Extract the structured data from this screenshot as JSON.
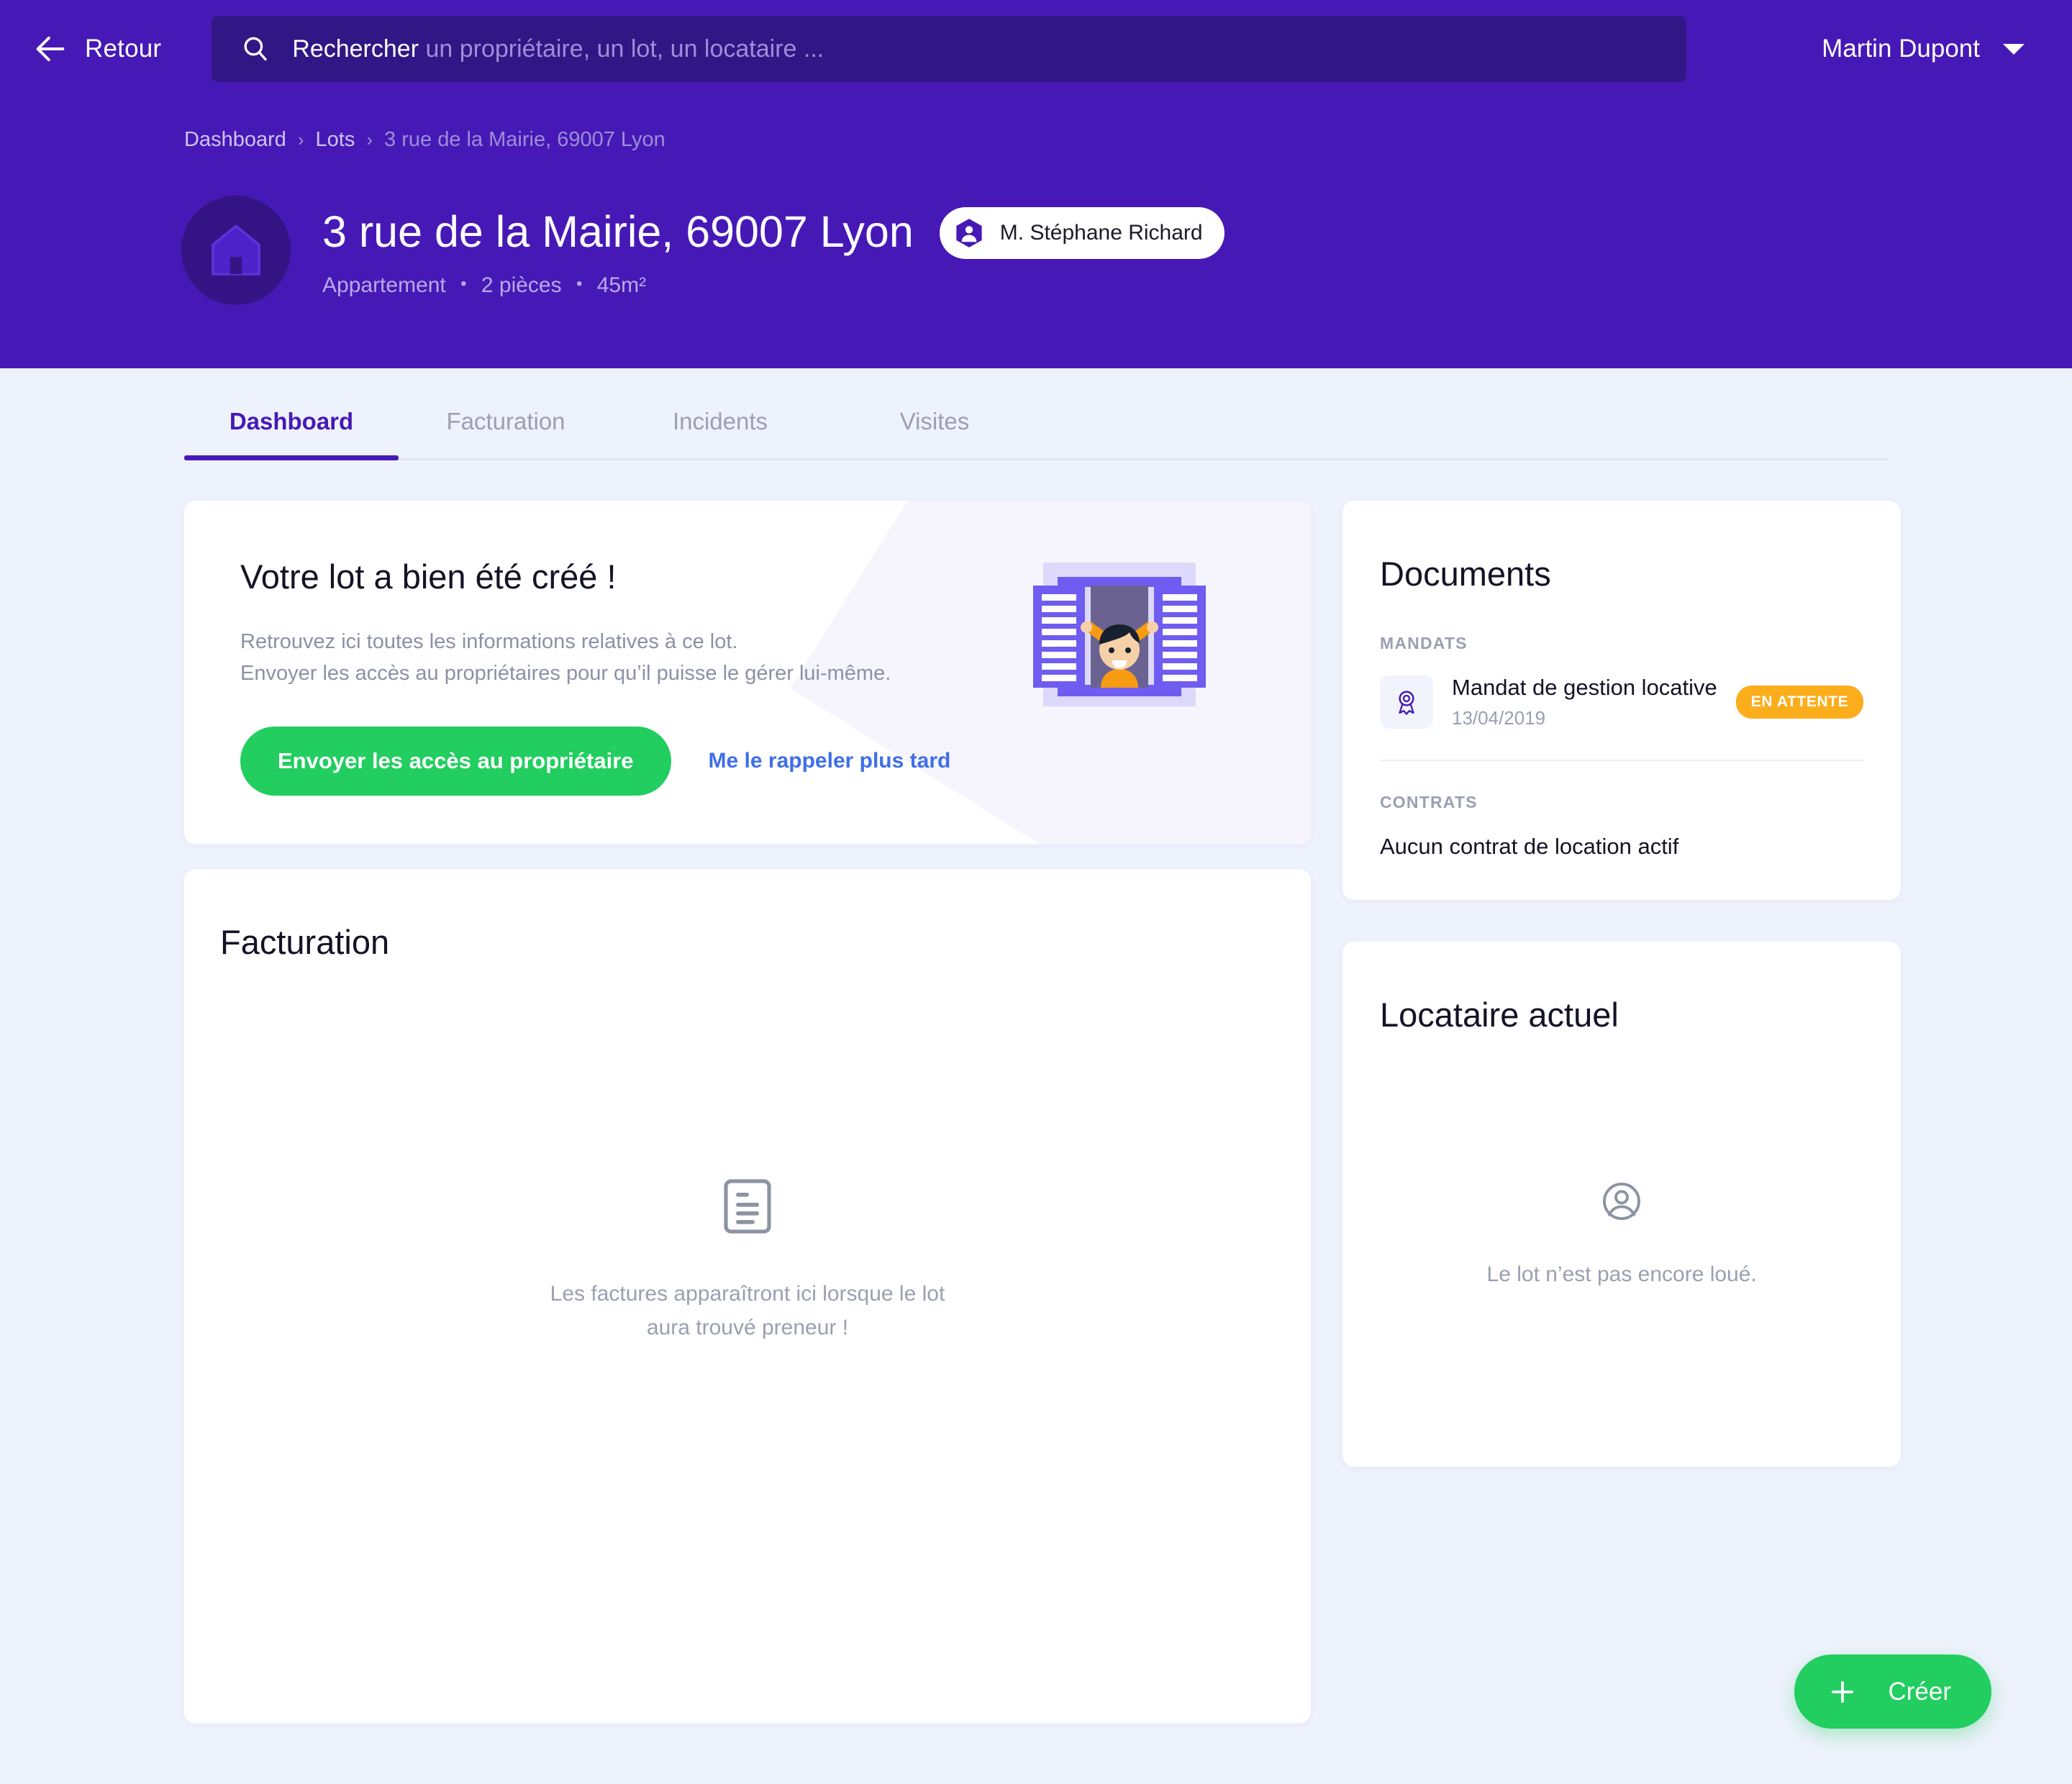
{
  "theme": {
    "header_purple": "#4619B6",
    "search_fill": "#311685",
    "page_bg": "#EEF2FC",
    "accent_green": "#21CE5F",
    "accent_blue_link": "#3F6FE8",
    "badge_amber": "#FBAD1B",
    "muted_text": "#9AA0B0"
  },
  "topbar": {
    "back_label": "Retour",
    "back_icon": "arrow-left-icon",
    "search_icon": "search-icon",
    "search_value": "Rechercher",
    "search_placeholder": "un propriétaire, un lot, un locataire ...",
    "user_name": "Martin Dupont",
    "user_caret_icon": "chevron-down-icon"
  },
  "breadcrumb": {
    "separator": "›",
    "items": [
      {
        "label": "Dashboard",
        "current": false
      },
      {
        "label": "Lots",
        "current": false
      },
      {
        "label": "3 rue de la Mairie, 69007 Lyon",
        "current": true
      }
    ]
  },
  "lot_header": {
    "avatar_icon": "house-icon",
    "title": "3 rue de la Mairie, 69007 Lyon",
    "owner_chip": {
      "icon": "user-hexagon-icon",
      "name": "M. Stéphane Richard"
    },
    "meta": {
      "type": "Appartement",
      "rooms": "2 pièces",
      "surface": "45m²",
      "separator": "•"
    }
  },
  "tabs": [
    {
      "label": "Dashboard",
      "active": true
    },
    {
      "label": "Facturation",
      "active": false
    },
    {
      "label": "Incidents",
      "active": false
    },
    {
      "label": "Visites",
      "active": false
    }
  ],
  "welcome_card": {
    "title": "Votre lot a bien été créé !",
    "line1": "Retrouvez ici toutes les informations relatives à ce lot.",
    "line2": "Envoyer les accès au propriétaires pour qu’il puisse le gérer lui-même.",
    "primary_button": "Envoyer les accès au propriétaire",
    "secondary_link": "Me le rappeler plus tard",
    "illustration": "open-window-person-icon"
  },
  "facturation_card": {
    "title": "Facturation",
    "empty_icon": "invoice-document-icon",
    "empty_line1": "Les factures apparaîtront ici lorsque le lot",
    "empty_line2": "aura trouvé preneur !"
  },
  "documents_card": {
    "title": "Documents",
    "mandats_label": "MANDATS",
    "mandats": [
      {
        "icon": "award-ribbon-icon",
        "name": "Mandat de gestion locative",
        "date": "13/04/2019",
        "status": "EN ATTENTE"
      }
    ],
    "contrats_label": "CONTRATS",
    "contrats_empty": "Aucun contrat de location actif"
  },
  "locataire_card": {
    "title": "Locataire actuel",
    "empty_icon": "user-circle-icon",
    "empty_message": "Le lot n’est pas encore loué."
  },
  "fab": {
    "icon": "plus-icon",
    "label": "Créer"
  }
}
